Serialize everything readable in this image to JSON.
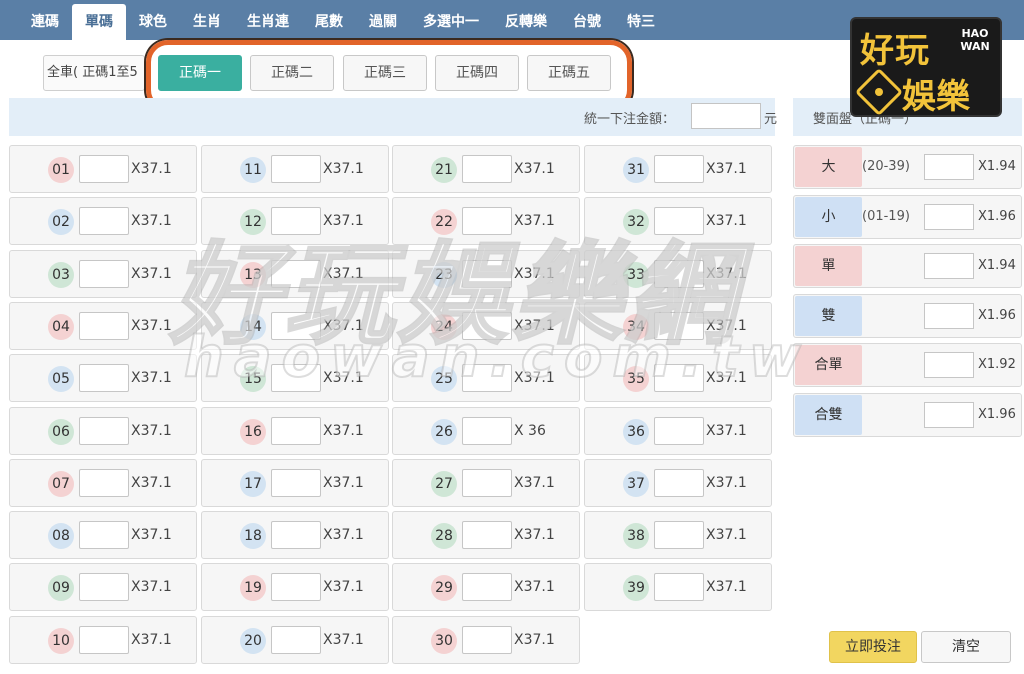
{
  "nav": {
    "tabs": [
      {
        "label": "連碼",
        "active": false
      },
      {
        "label": "單碼",
        "active": true
      },
      {
        "label": "球色",
        "active": false
      },
      {
        "label": "生肖",
        "active": false
      },
      {
        "label": "生肖連",
        "active": false
      },
      {
        "label": "尾數",
        "active": false
      },
      {
        "label": "過關",
        "active": false
      },
      {
        "label": "多選中一",
        "active": false
      },
      {
        "label": "反轉樂",
        "active": false
      },
      {
        "label": "台號",
        "active": false
      },
      {
        "label": "特三",
        "active": false
      }
    ]
  },
  "subtabs": {
    "all_label": "全車( 正碼1至5",
    "items": [
      {
        "label": "正碼一",
        "active": true
      },
      {
        "label": "正碼二",
        "active": false
      },
      {
        "label": "正碼三",
        "active": false
      },
      {
        "label": "正碼四",
        "active": false
      },
      {
        "label": "正碼五",
        "active": false
      }
    ]
  },
  "amount": {
    "label": "統一下注金額：",
    "value": "",
    "unit": "元"
  },
  "numbers": [
    {
      "num": "01",
      "color": "red",
      "odds": "X37.1"
    },
    {
      "num": "02",
      "color": "blue",
      "odds": "X37.1"
    },
    {
      "num": "03",
      "color": "green",
      "odds": "X37.1"
    },
    {
      "num": "04",
      "color": "red",
      "odds": "X37.1"
    },
    {
      "num": "05",
      "color": "blue",
      "odds": "X37.1"
    },
    {
      "num": "06",
      "color": "green",
      "odds": "X37.1"
    },
    {
      "num": "07",
      "color": "red",
      "odds": "X37.1"
    },
    {
      "num": "08",
      "color": "blue",
      "odds": "X37.1"
    },
    {
      "num": "09",
      "color": "green",
      "odds": "X37.1"
    },
    {
      "num": "10",
      "color": "red",
      "odds": "X37.1"
    },
    {
      "num": "11",
      "color": "blue",
      "odds": "X37.1"
    },
    {
      "num": "12",
      "color": "green",
      "odds": "X37.1"
    },
    {
      "num": "13",
      "color": "red",
      "odds": "X37.1"
    },
    {
      "num": "14",
      "color": "blue",
      "odds": "X37.1"
    },
    {
      "num": "15",
      "color": "green",
      "odds": "X37.1"
    },
    {
      "num": "16",
      "color": "red",
      "odds": "X37.1"
    },
    {
      "num": "17",
      "color": "blue",
      "odds": "X37.1"
    },
    {
      "num": "18",
      "color": "blue",
      "odds": "X37.1"
    },
    {
      "num": "19",
      "color": "red",
      "odds": "X37.1"
    },
    {
      "num": "20",
      "color": "blue",
      "odds": "X37.1"
    },
    {
      "num": "21",
      "color": "green",
      "odds": "X37.1"
    },
    {
      "num": "22",
      "color": "red",
      "odds": "X37.1"
    },
    {
      "num": "23",
      "color": "blue",
      "odds": "X37.1"
    },
    {
      "num": "24",
      "color": "red",
      "odds": "X37.1"
    },
    {
      "num": "25",
      "color": "blue",
      "odds": "X37.1"
    },
    {
      "num": "26",
      "color": "blue",
      "odds": "X 36"
    },
    {
      "num": "27",
      "color": "green",
      "odds": "X37.1"
    },
    {
      "num": "28",
      "color": "green",
      "odds": "X37.1"
    },
    {
      "num": "29",
      "color": "red",
      "odds": "X37.1"
    },
    {
      "num": "30",
      "color": "red",
      "odds": "X37.1"
    },
    {
      "num": "31",
      "color": "blue",
      "odds": "X37.1"
    },
    {
      "num": "32",
      "color": "green",
      "odds": "X37.1"
    },
    {
      "num": "33",
      "color": "green",
      "odds": "X37.1"
    },
    {
      "num": "34",
      "color": "red",
      "odds": "X37.1"
    },
    {
      "num": "35",
      "color": "red",
      "odds": "X37.1"
    },
    {
      "num": "36",
      "color": "blue",
      "odds": "X37.1"
    },
    {
      "num": "37",
      "color": "blue",
      "odds": "X37.1"
    },
    {
      "num": "38",
      "color": "green",
      "odds": "X37.1"
    },
    {
      "num": "39",
      "color": "green",
      "odds": "X37.1"
    }
  ],
  "two_sides": {
    "header": "雙面盤（正碼一）",
    "rows": [
      {
        "label": "大",
        "range": "(20-39)",
        "odds": "X1.94",
        "color": "red"
      },
      {
        "label": "小",
        "range": "(01-19)",
        "odds": "X1.96",
        "color": "blue"
      },
      {
        "label": "單",
        "range": "",
        "odds": "X1.94",
        "color": "red"
      },
      {
        "label": "雙",
        "range": "",
        "odds": "X1.96",
        "color": "blue"
      },
      {
        "label": "合單",
        "range": "",
        "odds": "X1.92",
        "color": "red"
      },
      {
        "label": "合雙",
        "range": "",
        "odds": "X1.96",
        "color": "blue"
      }
    ]
  },
  "buttons": {
    "submit": "立即投注",
    "clear": "清空"
  },
  "logo": {
    "cn_top": "好玩",
    "en_line1": "HAO",
    "en_line2": "WAN",
    "cn_bottom": "娛樂"
  },
  "watermark": {
    "big": "好玩娛樂網",
    "small": "haowan.com.tw"
  }
}
